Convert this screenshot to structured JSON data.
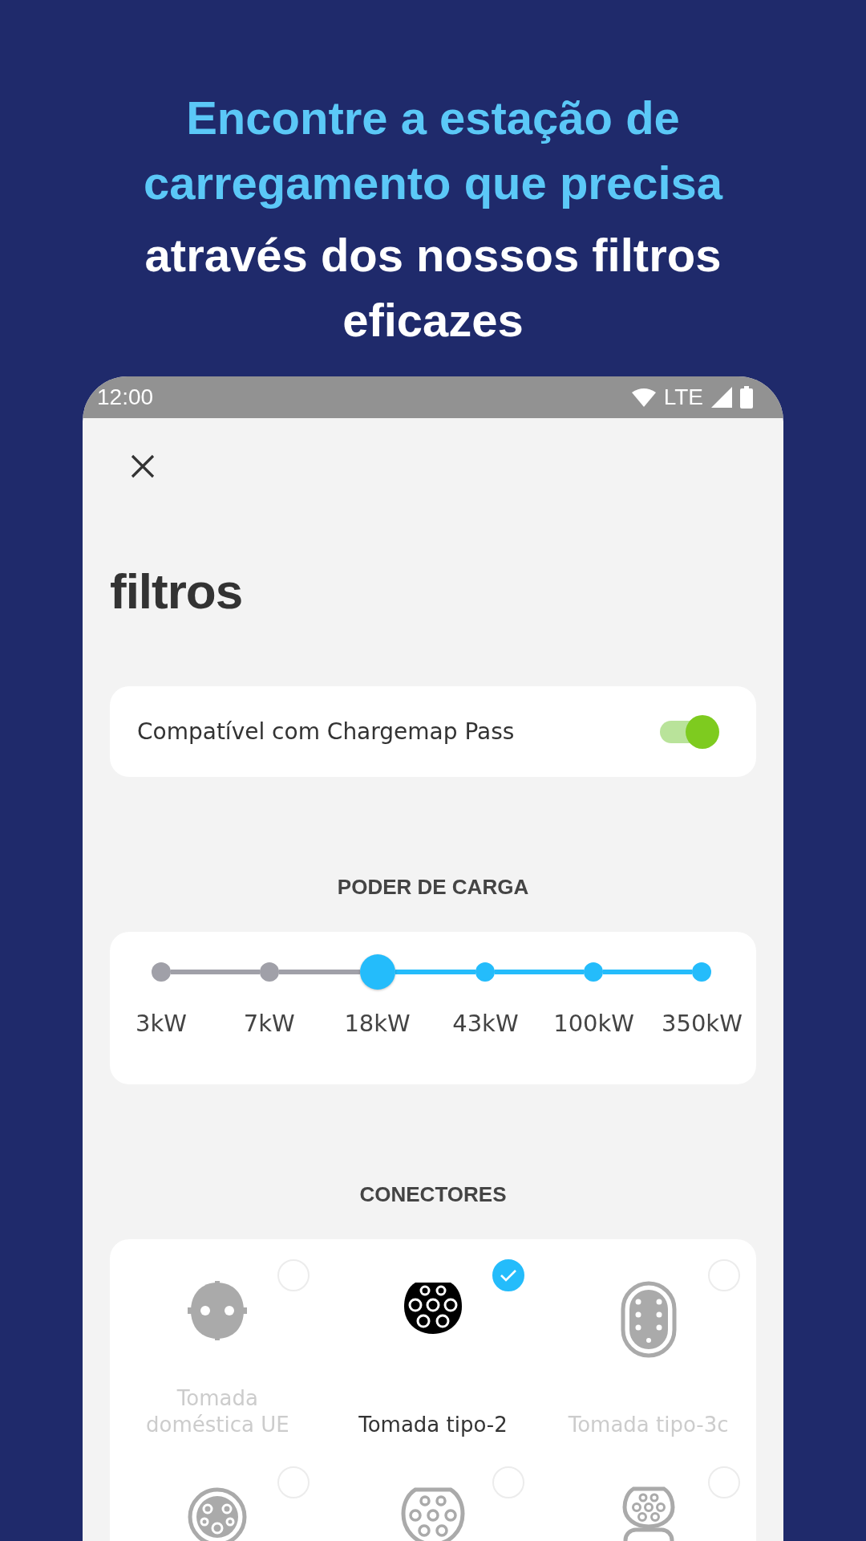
{
  "headline": {
    "highlight_lines": [
      "Encontre a estação de",
      "carregamento que precisa"
    ],
    "lines": [
      "através dos nossos filtros",
      "eficazes"
    ]
  },
  "status_bar": {
    "time": "12:00",
    "network": "LTE"
  },
  "title": "filtros",
  "pass_filter": {
    "label": "Compatível com Chargemap Pass",
    "on": true
  },
  "power": {
    "heading": "PODER DE CARGA",
    "steps": [
      {
        "label": "3kW",
        "selected": false
      },
      {
        "label": "7kW",
        "selected": false
      },
      {
        "label": "18kW",
        "selected": true
      },
      {
        "label": "43kW",
        "selected": false
      },
      {
        "label": "100kW",
        "selected": false
      },
      {
        "label": "350kW",
        "selected": false
      }
    ]
  },
  "connectors": {
    "heading": "CONECTORES",
    "items": [
      {
        "kind": "socket",
        "label": "Tomada doméstica UE",
        "selected": false
      },
      {
        "kind": "type2",
        "label": "Tomada tipo-2",
        "selected": true
      },
      {
        "kind": "type3c",
        "label": "Tomada tipo-3c",
        "selected": false
      },
      {
        "kind": "combo1",
        "selected": false
      },
      {
        "kind": "combo2a",
        "selected": false
      },
      {
        "kind": "combo2",
        "selected": false
      }
    ]
  }
}
